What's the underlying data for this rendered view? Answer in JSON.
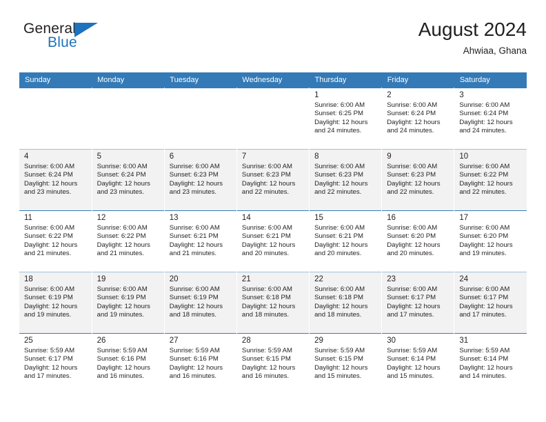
{
  "brand": {
    "name_part1": "General",
    "name_part2": "Blue",
    "flag_icon": "blue-triangle-flag-icon"
  },
  "header": {
    "title": "August 2024",
    "subtitle": "Ahwiaa, Ghana"
  },
  "colors": {
    "header_blue": "#337ab7",
    "brand_blue": "#1f72bd",
    "row_shade": "#f2f2f2",
    "text": "#231f20"
  },
  "weekday_headers": [
    "Sunday",
    "Monday",
    "Tuesday",
    "Wednesday",
    "Thursday",
    "Friday",
    "Saturday"
  ],
  "weeks": [
    {
      "shaded": false,
      "days": [
        {
          "empty": true
        },
        {
          "empty": true
        },
        {
          "empty": true
        },
        {
          "empty": true
        },
        {
          "day": "1",
          "sunrise": "Sunrise: 6:00 AM",
          "sunset": "Sunset: 6:25 PM",
          "daylight_line1": "Daylight: 12 hours",
          "daylight_line2": "and 24 minutes."
        },
        {
          "day": "2",
          "sunrise": "Sunrise: 6:00 AM",
          "sunset": "Sunset: 6:24 PM",
          "daylight_line1": "Daylight: 12 hours",
          "daylight_line2": "and 24 minutes."
        },
        {
          "day": "3",
          "sunrise": "Sunrise: 6:00 AM",
          "sunset": "Sunset: 6:24 PM",
          "daylight_line1": "Daylight: 12 hours",
          "daylight_line2": "and 24 minutes."
        }
      ]
    },
    {
      "shaded": true,
      "days": [
        {
          "day": "4",
          "sunrise": "Sunrise: 6:00 AM",
          "sunset": "Sunset: 6:24 PM",
          "daylight_line1": "Daylight: 12 hours",
          "daylight_line2": "and 23 minutes."
        },
        {
          "day": "5",
          "sunrise": "Sunrise: 6:00 AM",
          "sunset": "Sunset: 6:24 PM",
          "daylight_line1": "Daylight: 12 hours",
          "daylight_line2": "and 23 minutes."
        },
        {
          "day": "6",
          "sunrise": "Sunrise: 6:00 AM",
          "sunset": "Sunset: 6:23 PM",
          "daylight_line1": "Daylight: 12 hours",
          "daylight_line2": "and 23 minutes."
        },
        {
          "day": "7",
          "sunrise": "Sunrise: 6:00 AM",
          "sunset": "Sunset: 6:23 PM",
          "daylight_line1": "Daylight: 12 hours",
          "daylight_line2": "and 22 minutes."
        },
        {
          "day": "8",
          "sunrise": "Sunrise: 6:00 AM",
          "sunset": "Sunset: 6:23 PM",
          "daylight_line1": "Daylight: 12 hours",
          "daylight_line2": "and 22 minutes."
        },
        {
          "day": "9",
          "sunrise": "Sunrise: 6:00 AM",
          "sunset": "Sunset: 6:23 PM",
          "daylight_line1": "Daylight: 12 hours",
          "daylight_line2": "and 22 minutes."
        },
        {
          "day": "10",
          "sunrise": "Sunrise: 6:00 AM",
          "sunset": "Sunset: 6:22 PM",
          "daylight_line1": "Daylight: 12 hours",
          "daylight_line2": "and 22 minutes."
        }
      ]
    },
    {
      "shaded": false,
      "days": [
        {
          "day": "11",
          "sunrise": "Sunrise: 6:00 AM",
          "sunset": "Sunset: 6:22 PM",
          "daylight_line1": "Daylight: 12 hours",
          "daylight_line2": "and 21 minutes."
        },
        {
          "day": "12",
          "sunrise": "Sunrise: 6:00 AM",
          "sunset": "Sunset: 6:22 PM",
          "daylight_line1": "Daylight: 12 hours",
          "daylight_line2": "and 21 minutes."
        },
        {
          "day": "13",
          "sunrise": "Sunrise: 6:00 AM",
          "sunset": "Sunset: 6:21 PM",
          "daylight_line1": "Daylight: 12 hours",
          "daylight_line2": "and 21 minutes."
        },
        {
          "day": "14",
          "sunrise": "Sunrise: 6:00 AM",
          "sunset": "Sunset: 6:21 PM",
          "daylight_line1": "Daylight: 12 hours",
          "daylight_line2": "and 20 minutes."
        },
        {
          "day": "15",
          "sunrise": "Sunrise: 6:00 AM",
          "sunset": "Sunset: 6:21 PM",
          "daylight_line1": "Daylight: 12 hours",
          "daylight_line2": "and 20 minutes."
        },
        {
          "day": "16",
          "sunrise": "Sunrise: 6:00 AM",
          "sunset": "Sunset: 6:20 PM",
          "daylight_line1": "Daylight: 12 hours",
          "daylight_line2": "and 20 minutes."
        },
        {
          "day": "17",
          "sunrise": "Sunrise: 6:00 AM",
          "sunset": "Sunset: 6:20 PM",
          "daylight_line1": "Daylight: 12 hours",
          "daylight_line2": "and 19 minutes."
        }
      ]
    },
    {
      "shaded": true,
      "days": [
        {
          "day": "18",
          "sunrise": "Sunrise: 6:00 AM",
          "sunset": "Sunset: 6:19 PM",
          "daylight_line1": "Daylight: 12 hours",
          "daylight_line2": "and 19 minutes."
        },
        {
          "day": "19",
          "sunrise": "Sunrise: 6:00 AM",
          "sunset": "Sunset: 6:19 PM",
          "daylight_line1": "Daylight: 12 hours",
          "daylight_line2": "and 19 minutes."
        },
        {
          "day": "20",
          "sunrise": "Sunrise: 6:00 AM",
          "sunset": "Sunset: 6:19 PM",
          "daylight_line1": "Daylight: 12 hours",
          "daylight_line2": "and 18 minutes."
        },
        {
          "day": "21",
          "sunrise": "Sunrise: 6:00 AM",
          "sunset": "Sunset: 6:18 PM",
          "daylight_line1": "Daylight: 12 hours",
          "daylight_line2": "and 18 minutes."
        },
        {
          "day": "22",
          "sunrise": "Sunrise: 6:00 AM",
          "sunset": "Sunset: 6:18 PM",
          "daylight_line1": "Daylight: 12 hours",
          "daylight_line2": "and 18 minutes."
        },
        {
          "day": "23",
          "sunrise": "Sunrise: 6:00 AM",
          "sunset": "Sunset: 6:17 PM",
          "daylight_line1": "Daylight: 12 hours",
          "daylight_line2": "and 17 minutes."
        },
        {
          "day": "24",
          "sunrise": "Sunrise: 6:00 AM",
          "sunset": "Sunset: 6:17 PM",
          "daylight_line1": "Daylight: 12 hours",
          "daylight_line2": "and 17 minutes."
        }
      ]
    },
    {
      "shaded": false,
      "days": [
        {
          "day": "25",
          "sunrise": "Sunrise: 5:59 AM",
          "sunset": "Sunset: 6:17 PM",
          "daylight_line1": "Daylight: 12 hours",
          "daylight_line2": "and 17 minutes."
        },
        {
          "day": "26",
          "sunrise": "Sunrise: 5:59 AM",
          "sunset": "Sunset: 6:16 PM",
          "daylight_line1": "Daylight: 12 hours",
          "daylight_line2": "and 16 minutes."
        },
        {
          "day": "27",
          "sunrise": "Sunrise: 5:59 AM",
          "sunset": "Sunset: 6:16 PM",
          "daylight_line1": "Daylight: 12 hours",
          "daylight_line2": "and 16 minutes."
        },
        {
          "day": "28",
          "sunrise": "Sunrise: 5:59 AM",
          "sunset": "Sunset: 6:15 PM",
          "daylight_line1": "Daylight: 12 hours",
          "daylight_line2": "and 16 minutes."
        },
        {
          "day": "29",
          "sunrise": "Sunrise: 5:59 AM",
          "sunset": "Sunset: 6:15 PM",
          "daylight_line1": "Daylight: 12 hours",
          "daylight_line2": "and 15 minutes."
        },
        {
          "day": "30",
          "sunrise": "Sunrise: 5:59 AM",
          "sunset": "Sunset: 6:14 PM",
          "daylight_line1": "Daylight: 12 hours",
          "daylight_line2": "and 15 minutes."
        },
        {
          "day": "31",
          "sunrise": "Sunrise: 5:59 AM",
          "sunset": "Sunset: 6:14 PM",
          "daylight_line1": "Daylight: 12 hours",
          "daylight_line2": "and 14 minutes."
        }
      ]
    }
  ]
}
